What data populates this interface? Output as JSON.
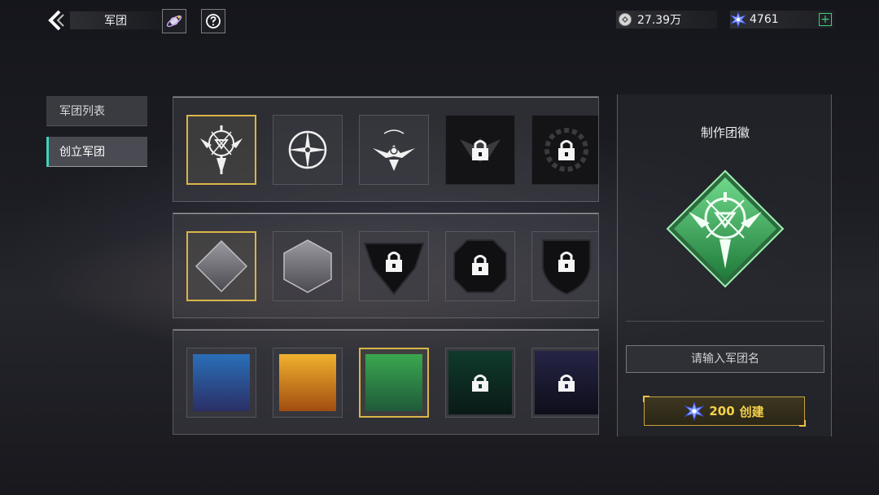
{
  "header": {
    "title": "军团",
    "gold_amount": "27.39万",
    "crystal_amount": "4761",
    "plus_label": "+"
  },
  "sidebar": {
    "items": [
      {
        "label": "军团列表",
        "active": false
      },
      {
        "label": "创立军团",
        "active": true
      }
    ]
  },
  "emblem_row": {
    "items": [
      {
        "icon": "winged-sword-emblem",
        "locked": false,
        "selected": true
      },
      {
        "icon": "crosshair-emblem",
        "locked": false,
        "selected": false
      },
      {
        "icon": "winged-arc-emblem",
        "locked": false,
        "selected": false
      },
      {
        "icon": "lock-icon",
        "locked": true,
        "selected": false
      },
      {
        "icon": "lock-icon",
        "locked": true,
        "selected": false
      }
    ]
  },
  "shape_row": {
    "items": [
      {
        "icon": "diamond-shape",
        "locked": false,
        "selected": true
      },
      {
        "icon": "hexagon-shape",
        "locked": false,
        "selected": false
      },
      {
        "icon": "lock-icon",
        "locked": true,
        "selected": false
      },
      {
        "icon": "lock-icon",
        "locked": true,
        "selected": false
      },
      {
        "icon": "lock-icon",
        "locked": true,
        "selected": false
      }
    ]
  },
  "color_row": {
    "items": [
      {
        "color_top": "#2a6fb8",
        "color_bottom": "#2b2f66",
        "locked": false,
        "selected": false
      },
      {
        "color_top": "#f0b12e",
        "color_bottom": "#a24d10",
        "locked": false,
        "selected": false
      },
      {
        "color_top": "#3aa84f",
        "color_bottom": "#1f5a3a",
        "locked": false,
        "selected": true
      },
      {
        "color_top": "#0f3a2c",
        "color_bottom": "#0a1a16",
        "locked": true,
        "selected": false
      },
      {
        "color_top": "#252445",
        "color_bottom": "#0e0e1a",
        "locked": true,
        "selected": false
      }
    ]
  },
  "preview": {
    "title": "制作团徽",
    "emblem_color": "#35a852"
  },
  "form": {
    "name_placeholder": "请输入军团名"
  },
  "create_button": {
    "cost": "200",
    "label": "创建"
  },
  "colors": {
    "selection": "#d9b54a",
    "accent_teal": "#41d1b8",
    "gold_text": "#f5d24a"
  }
}
